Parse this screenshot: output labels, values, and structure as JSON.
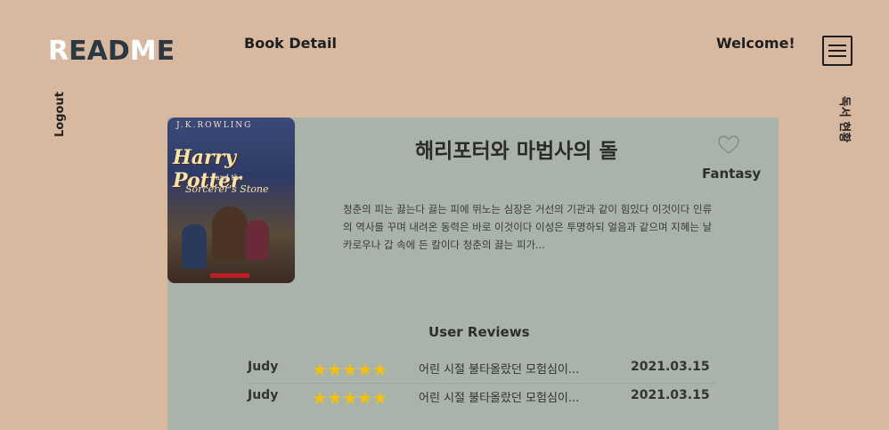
{
  "header": {
    "logo": [
      "R",
      "EAD",
      "M",
      "E"
    ],
    "page_title": "Book Detail",
    "welcome": "Welcome!",
    "menu_icon": "hamburger-menu-icon"
  },
  "side": {
    "logout": "Logout",
    "reading_status": "독서 현황"
  },
  "book": {
    "cover": {
      "author": "J.K.ROWLING",
      "title_line1": "Harry Potter",
      "title_line2": "and the",
      "title_line3": "Sorcerer's Stone"
    },
    "title": "해리포터와 마법사의 돌",
    "genre": "Fantasy",
    "favorite_icon": "heart-outline-icon",
    "description": "청춘의 피는 끓는다 끓는 피에 뛰노는 심장은 거선의 기관과 같이 힘있다 이것이다 인류의 역사를 꾸며 내려온 동력은 바로 이것이다 이성은 투명하되 얼음과 같으며 지혜는 날카로우나 갑 속에 든 칼이다 청춘의 끓는 피가..."
  },
  "reviews": {
    "title": "User Reviews",
    "items": [
      {
        "user": "Judy",
        "rating": 5,
        "stars": "★★★★★",
        "text": "어린 시절 불타올랐던 모험심이...",
        "date": "2021.03.15"
      },
      {
        "user": "Judy",
        "rating": 5,
        "stars": "★★★★★",
        "text": "어린 시절 불타올랐던 모험심이...",
        "date": "2021.03.15"
      }
    ]
  },
  "colors": {
    "background": "#d9b8a0",
    "card": "#aab3aa",
    "star": "#f2c10f"
  }
}
